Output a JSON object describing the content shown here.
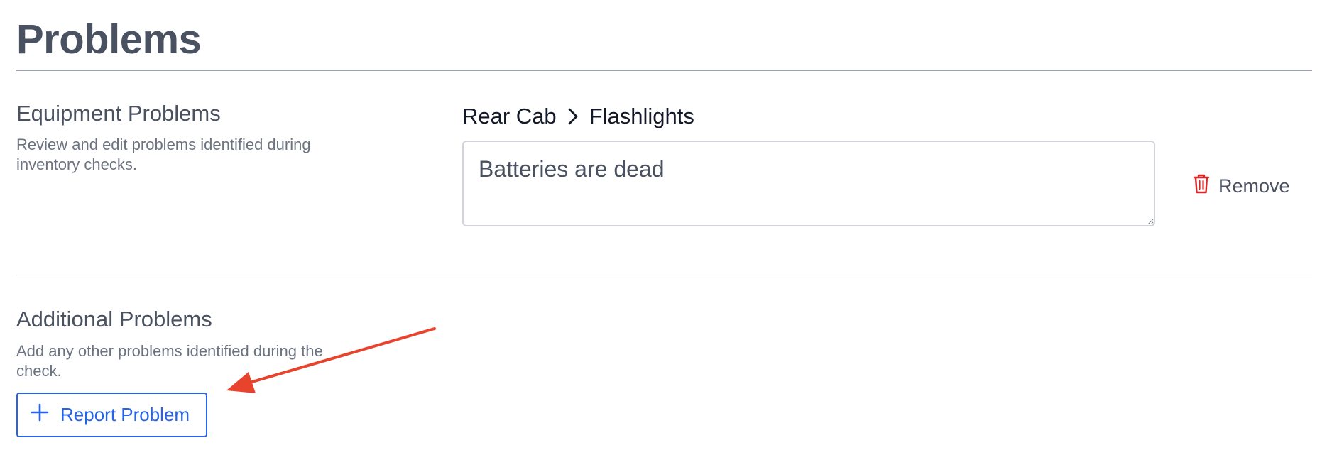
{
  "page": {
    "title": "Problems"
  },
  "equipment_problems": {
    "heading": "Equipment Problems",
    "description": "Review and edit problems identified during inventory checks.",
    "item": {
      "breadcrumb": [
        "Rear Cab",
        "Flashlights"
      ],
      "problem_text": "Batteries are dead",
      "remove_label": "Remove"
    }
  },
  "additional_problems": {
    "heading": "Additional Problems",
    "description": "Add any other problems identified during the check.",
    "report_button_label": "Report Problem"
  },
  "icons": {
    "breadcrumb_separator": "chevron-right-icon",
    "remove": "trash-icon",
    "report": "plus-icon",
    "annotation": "red-arrow"
  },
  "colors": {
    "accent": "#2563eb",
    "danger": "#dc2626",
    "annotation": "#e8432d",
    "heading": "#4a5261"
  }
}
